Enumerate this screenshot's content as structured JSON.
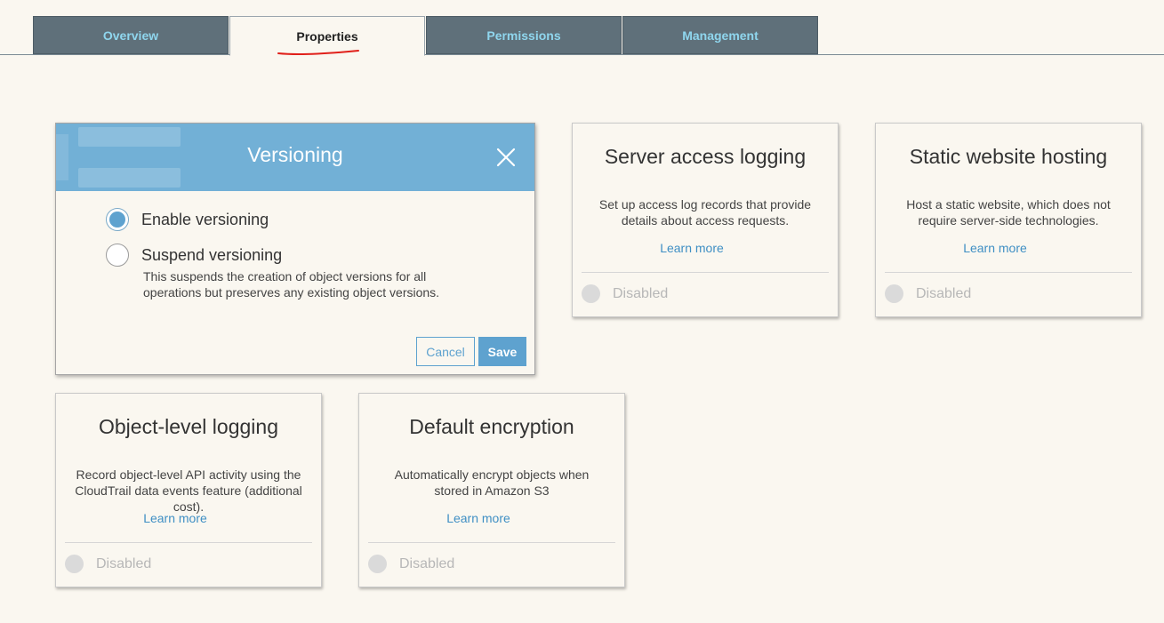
{
  "tabs": [
    {
      "label": "Overview"
    },
    {
      "label": "Properties"
    },
    {
      "label": "Permissions"
    },
    {
      "label": "Management"
    }
  ],
  "versioning": {
    "title": "Versioning",
    "enable_label": "Enable versioning",
    "suspend_label": "Suspend versioning",
    "suspend_help": "This suspends the creation of object versions for all operations but preserves any existing object versions.",
    "cancel_label": "Cancel",
    "save_label": "Save"
  },
  "cards": {
    "server_access_logging": {
      "title": "Server access logging",
      "description": "Set up access log records that provide details about access requests.",
      "link": "Learn more",
      "status": "Disabled"
    },
    "static_website_hosting": {
      "title": "Static website hosting",
      "description": "Host a static website, which does not require server-side technologies.",
      "link": "Learn more",
      "status": "Disabled"
    },
    "object_level_logging": {
      "title": "Object-level logging",
      "description": "Record object-level API activity using the CloudTrail data events feature (additional cost).",
      "link": "Learn more",
      "status": "Disabled"
    },
    "default_encryption": {
      "title": "Default encryption",
      "description": "Automatically encrypt objects when stored in Amazon S3",
      "link": "Learn more",
      "status": "Disabled"
    }
  },
  "colors": {
    "tab_bg": "#5f707a",
    "tab_text": "#8fd6ee",
    "accent": "#5ea2cf",
    "modal_header": "#72b0d6",
    "annotation": "#e0201a"
  }
}
